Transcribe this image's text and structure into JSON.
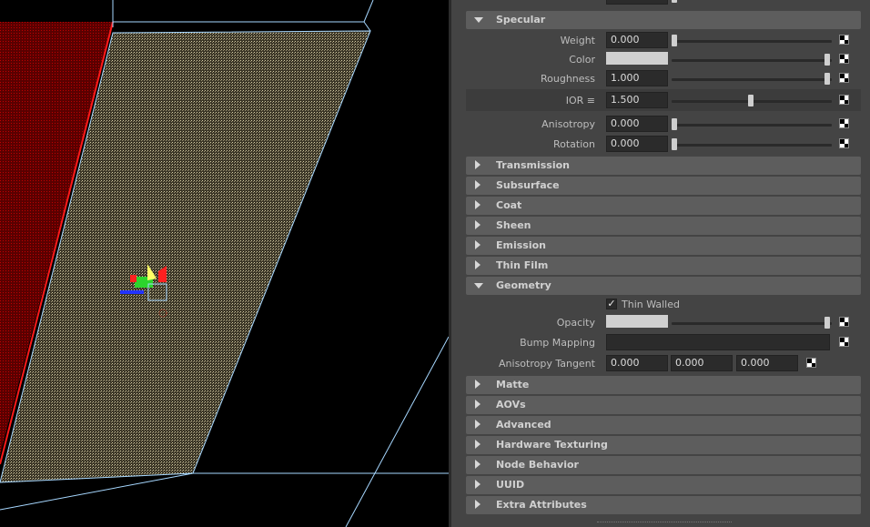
{
  "specular": {
    "header": "Specular",
    "weight": {
      "label": "Weight",
      "value": "0.000",
      "level": 0.0
    },
    "color": {
      "label": "Color",
      "swatch": "#d0d0d0",
      "level": 1.0
    },
    "roughness": {
      "label": "Roughness",
      "value": "1.000",
      "level": 1.0
    },
    "ior": {
      "label": "IOR ≡",
      "value": "1.500",
      "level": 0.5
    },
    "anisotropy": {
      "label": "Anisotropy",
      "value": "0.000",
      "level": 0.0
    },
    "rotation": {
      "label": "Rotation",
      "value": "0.000",
      "level": 0.0
    }
  },
  "collapsed_sections": [
    "Transmission",
    "Subsurface",
    "Coat",
    "Sheen",
    "Emission",
    "Thin Film"
  ],
  "geometry": {
    "header": "Geometry",
    "thin_walled": {
      "label": "Thin Walled",
      "checked": true
    },
    "opacity": {
      "label": "Opacity",
      "swatch": "#d0d0d0",
      "level": 1.0
    },
    "bump_mapping": {
      "label": "Bump Mapping"
    },
    "anisotropy_tangent": {
      "label": "Anisotropy Tangent",
      "values": [
        "0.000",
        "0.000",
        "0.000"
      ]
    }
  },
  "lower_sections": [
    "Matte",
    "AOVs",
    "Advanced",
    "Hardware Texturing",
    "Node Behavior",
    "UUID",
    "Extra Attributes"
  ],
  "colors": {
    "viewport_bg": "#000000",
    "selected_edge": "#ff0000",
    "wire": "#a6d7ff",
    "panel_bg": "#444444",
    "section_bg": "#5d5d5d"
  }
}
